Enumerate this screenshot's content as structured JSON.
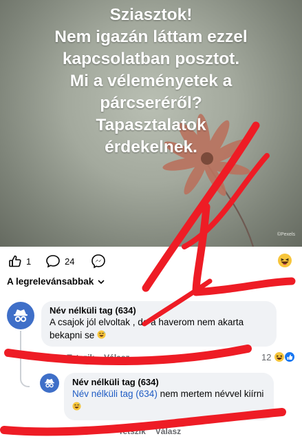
{
  "post": {
    "image_text_lines": [
      "Sziasztok!",
      "Nem igazán láttam ezzel",
      "kapcsolatban posztot.",
      "Mi a véleményetek a",
      "párcseréről?",
      "Tapasztalatok",
      "érdekelnek."
    ],
    "watermark": "©Pexels"
  },
  "reactions": {
    "like_count": "1",
    "comment_count": "24",
    "like_icon": "thumbs-up-icon",
    "comment_icon": "comment-bubble-icon",
    "share_icon": "messenger-icon",
    "emoji_icon": "laughing-emoji-icon"
  },
  "sort": {
    "label": "A legrelevánsabbak",
    "icon": "chevron-down-icon"
  },
  "comments": [
    {
      "author": "Név nélküli tag (634)",
      "text": "A csajok jól elvoltak , de a haverom nem akarta bekapni se",
      "emoji": "grinning-sweat-emoji",
      "actions": [
        "15",
        "Tetszik",
        "Válasz"
      ],
      "reaction_count": "12"
    },
    {
      "author": "Név nélküli tag (634)",
      "mention": "Név nélküli tag (634)",
      "text": " nem mertem névvel kiírni",
      "emoji": "grinning-sweat-emoji",
      "actions": [
        "Tetszik",
        "Válasz"
      ]
    }
  ],
  "colors": {
    "annotation_red": "#ee1c25",
    "avatar_blue": "#3f6fc8",
    "mention_blue": "#1f5cc4",
    "bubble_gray": "#f0f2f5",
    "post_background": "#a3a99d"
  }
}
